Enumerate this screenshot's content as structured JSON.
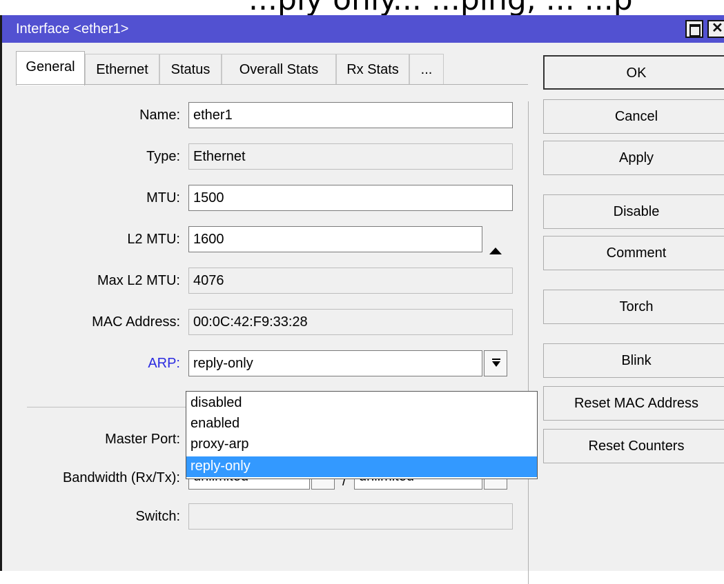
{
  "page": {
    "top_text": "...ply only... ...ping, ... ...p"
  },
  "window": {
    "title": "Interface <ether1>",
    "close_glyph": "✕"
  },
  "tabs": [
    {
      "label": "General",
      "active": true
    },
    {
      "label": "Ethernet",
      "active": false
    },
    {
      "label": "Status",
      "active": false
    },
    {
      "label": "Overall Stats",
      "active": false
    },
    {
      "label": "Rx Stats",
      "active": false
    },
    {
      "label": "...",
      "active": false
    }
  ],
  "fields": {
    "name": {
      "label": "Name:",
      "value": "ether1"
    },
    "type": {
      "label": "Type:",
      "value": "Ethernet"
    },
    "mtu": {
      "label": "MTU:",
      "value": "1500"
    },
    "l2mtu": {
      "label": "L2 MTU:",
      "value": "1600"
    },
    "max_l2mtu": {
      "label": "Max L2 MTU:",
      "value": "4076"
    },
    "mac": {
      "label": "MAC Address:",
      "value": "00:0C:42:F9:33:28"
    },
    "arp": {
      "label": "ARP:",
      "value": "reply-only"
    },
    "master_port": {
      "label": "Master Port:",
      "value": ""
    },
    "bandwidth": {
      "label": "Bandwidth (Rx/Tx):",
      "rx": "unlimited",
      "tx": "unlimited",
      "separator": "/"
    },
    "switch": {
      "label": "Switch:",
      "value": ""
    }
  },
  "arp_options": [
    "disabled",
    "enabled",
    "proxy-arp",
    "reply-only"
  ],
  "arp_selected": "reply-only",
  "buttons": {
    "ok": "OK",
    "cancel": "Cancel",
    "apply": "Apply",
    "disable": "Disable",
    "comment": "Comment",
    "torch": "Torch",
    "blink": "Blink",
    "reset_mac": "Reset MAC Address",
    "reset_counters": "Reset Counters"
  },
  "colors": {
    "titlebar": "#5251d1",
    "selection": "#3399ff",
    "arp_label": "#2b2be0"
  }
}
